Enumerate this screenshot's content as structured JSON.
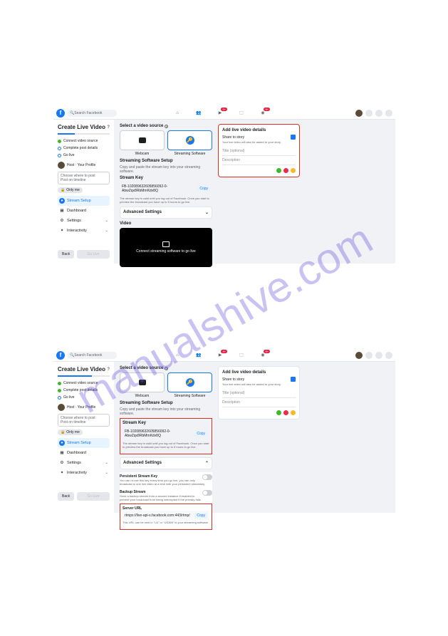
{
  "watermark": "manualshive.com",
  "header": {
    "search_placeholder": "Search Facebook",
    "badges": {
      "watch": "9+",
      "groups": "9+"
    }
  },
  "sidebar": {
    "title": "Create Live Video",
    "help": "?",
    "steps": {
      "s1": "Connect video source",
      "s2": "Complete post details",
      "s3": "Go live"
    },
    "user_label": "Host · Your Profile",
    "post_select_line1": "Choose where to post",
    "post_select_line2": "Post on timeline",
    "only_me": "Only me",
    "nav": {
      "stream": "Stream Setup",
      "dashboard": "Dashboard",
      "settings": "Settings",
      "interactivity": "Interactivity"
    },
    "back": "Back",
    "golive": "Go Live"
  },
  "main": {
    "select_source": "Select a video source",
    "webcam": "Webcam",
    "streaming_sw": "Streaming Software",
    "sw_setup_title": "Streaming Software Setup",
    "sw_setup_sub": "Copy and paste the stream key into your streaming software.",
    "stream_key_label": "Stream Key",
    "stream_key_value": "FB-102089632605856092-0-AbwZqx8RbMmKdv8Q",
    "copy": "Copy",
    "key_note": "The stream key is valid until you log out of Facebook. Once you start to preview the broadcast you have up to 5 hours to go live.",
    "adv_settings": "Advanced Settings",
    "video_label": "Video",
    "video_msg": "Connect streaming software to go live",
    "persistent_title": "Persistent Stream Key",
    "persistent_sub": "You can re-use this key every time you go live, you can only broadcast to one live video at a time with your persistent streamkey.",
    "backup_title": "Backup Stream",
    "backup_sub": "Send a backup stream from a second instance if enabled to prevent your broadcast from being interrupted if the primary fails.",
    "server_url_label": "Server URL",
    "server_url_value": "rtmps://live-api-s.facebook.com:443/rtmp/",
    "server_url_note": "This URL can be sent in \"LA\" or \"US365\" is your streaming software"
  },
  "details": {
    "title": "Add live video details",
    "share_label": "Share to story",
    "share_sub": "Your live video will also be added to your story.",
    "title_placeholder": "Title (optional)",
    "desc_placeholder": "Description"
  }
}
